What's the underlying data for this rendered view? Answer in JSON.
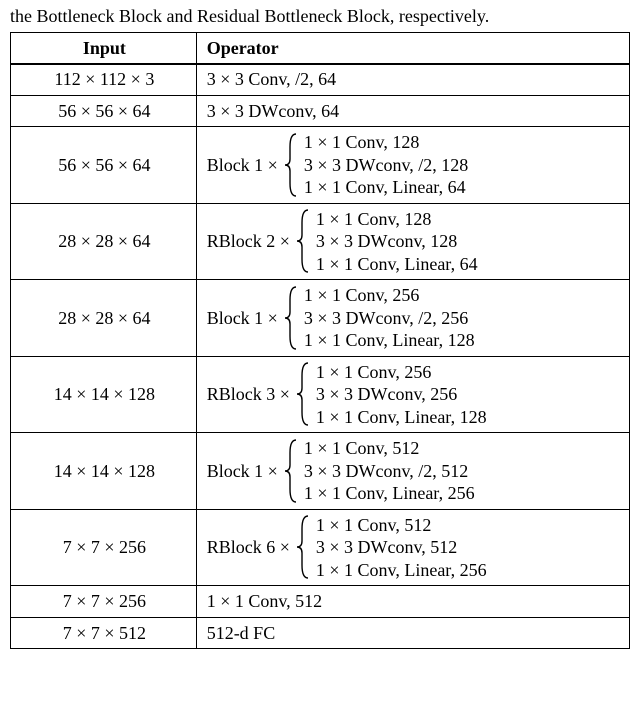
{
  "caption_fragment": "the Bottleneck Block and Residual Bottleneck Block, respectively.",
  "headers": {
    "input": "Input",
    "operator": "Operator"
  },
  "rows": [
    {
      "type": "simple",
      "input": "112 × 112 × 3",
      "op": "3 × 3 Conv, /2, 64"
    },
    {
      "type": "simple",
      "input": "56 × 56 × 64",
      "op": "3 × 3 DWconv, 64"
    },
    {
      "type": "block",
      "input": "56 × 56 × 64",
      "label": "Block 1 ×",
      "lines": [
        "1 × 1 Conv, 128",
        "3 × 3 DWconv, /2, 128",
        "1 × 1 Conv, Linear, 64"
      ]
    },
    {
      "type": "block",
      "input": "28 × 28 × 64",
      "label": "RBlock 2 ×",
      "lines": [
        "1 × 1 Conv, 128",
        "3 × 3 DWconv, 128",
        "1 × 1 Conv, Linear, 64"
      ]
    },
    {
      "type": "block",
      "input": "28 × 28 × 64",
      "label": "Block 1 ×",
      "lines": [
        "1 × 1 Conv, 256",
        "3 × 3 DWconv, /2, 256",
        "1 × 1 Conv, Linear, 128"
      ]
    },
    {
      "type": "block",
      "input": "14 × 14 × 128",
      "label": "RBlock 3 ×",
      "lines": [
        "1 × 1 Conv, 256",
        "3 × 3 DWconv, 256",
        "1 × 1 Conv, Linear, 128"
      ]
    },
    {
      "type": "block",
      "input": "14 × 14 × 128",
      "label": "Block 1 ×",
      "lines": [
        "1 × 1 Conv, 512",
        "3 × 3 DWconv, /2, 512",
        "1 × 1 Conv, Linear, 256"
      ]
    },
    {
      "type": "block",
      "input": "7 × 7 × 256",
      "label": "RBlock 6 ×",
      "lines": [
        "1 × 1 Conv, 512",
        "3 × 3 DWconv, 512",
        "1 × 1 Conv, Linear, 256"
      ]
    },
    {
      "type": "simple",
      "input": "7 × 7 × 256",
      "op": "1 × 1 Conv, 512"
    },
    {
      "type": "simple",
      "input": "7 × 7 × 512",
      "op": "512-d FC"
    }
  ],
  "chart_data": {
    "type": "table",
    "columns": [
      "Input",
      "Operator"
    ],
    "rows": [
      [
        "112 × 112 × 3",
        "3 × 3 Conv, /2, 64"
      ],
      [
        "56 × 56 × 64",
        "3 × 3 DWconv, 64"
      ],
      [
        "56 × 56 × 64",
        "Block 1 × { 1×1 Conv,128 ; 3×3 DWconv,/2,128 ; 1×1 Conv,Linear,64 }"
      ],
      [
        "28 × 28 × 64",
        "RBlock 2 × { 1×1 Conv,128 ; 3×3 DWconv,128 ; 1×1 Conv,Linear,64 }"
      ],
      [
        "28 × 28 × 64",
        "Block 1 × { 1×1 Conv,256 ; 3×3 DWconv,/2,256 ; 1×1 Conv,Linear,128 }"
      ],
      [
        "14 × 14 × 128",
        "RBlock 3 × { 1×1 Conv,256 ; 3×3 DWconv,256 ; 1×1 Conv,Linear,128 }"
      ],
      [
        "14 × 14 × 128",
        "Block 1 × { 1×1 Conv,512 ; 3×3 DWconv,/2,512 ; 1×1 Conv,Linear,256 }"
      ],
      [
        "7 × 7 × 256",
        "RBlock 6 × { 1×1 Conv,512 ; 3×3 DWconv,512 ; 1×1 Conv,Linear,256 }"
      ],
      [
        "7 × 7 × 256",
        "1 × 1 Conv, 512"
      ],
      [
        "7 × 7 × 512",
        "512-d FC"
      ]
    ]
  }
}
